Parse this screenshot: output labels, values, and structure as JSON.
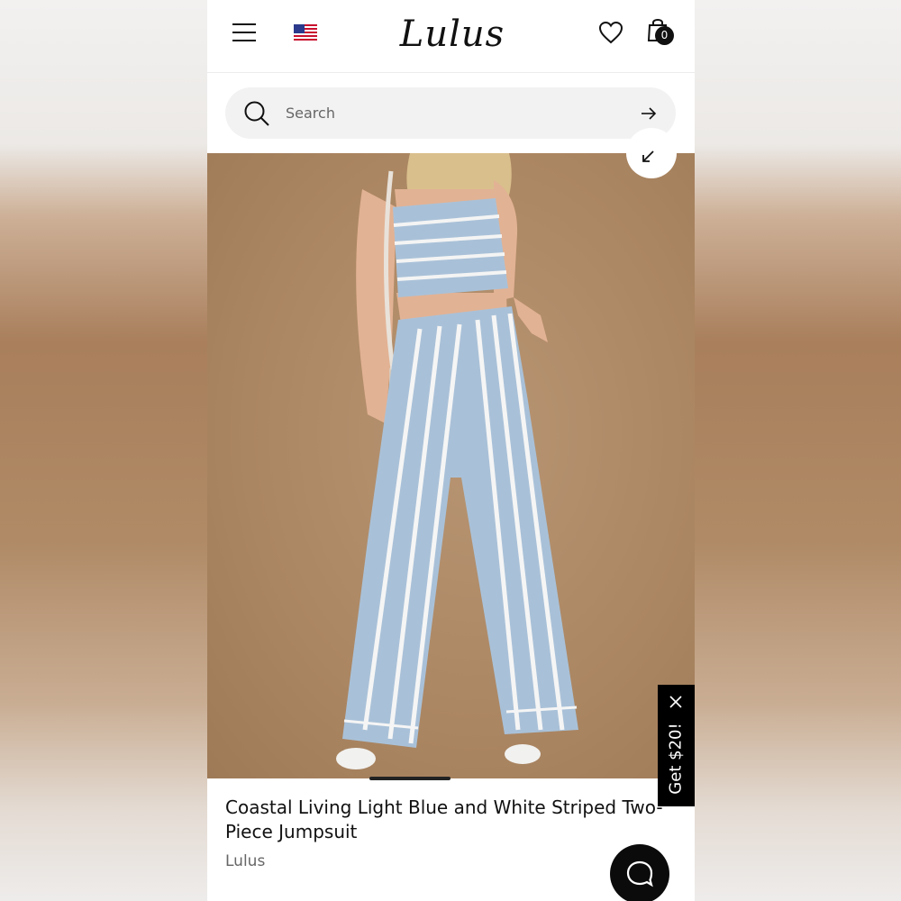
{
  "header": {
    "logo_text": "Lulus",
    "cart_count": "0",
    "icons": [
      "menu-icon",
      "us-flag-icon",
      "heart-icon",
      "shopping-bag-icon"
    ]
  },
  "search": {
    "placeholder": "Search"
  },
  "product": {
    "title": "Coastal Living Light Blue and White Striped Two-Piece Jumpsuit",
    "brand": "Lulus",
    "image_icon": "collapse-arrow-icon"
  },
  "promo": {
    "label": "Get $20!",
    "close_icon": "close-icon"
  },
  "chat": {
    "icon": "chat-bubble-icon"
  },
  "colors": {
    "accent": "#111111",
    "promo_bg": "#000000",
    "search_bg": "#f2f2f2"
  }
}
